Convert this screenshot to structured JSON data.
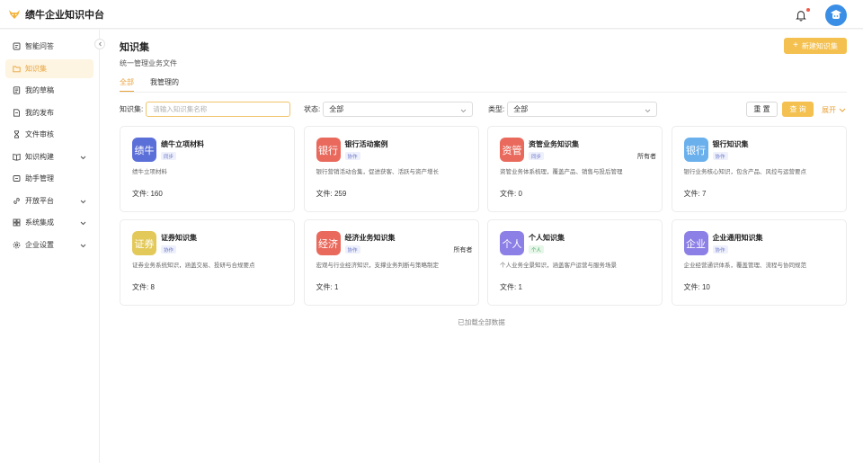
{
  "app": {
    "title": "绩牛企业知识中台"
  },
  "colors": {
    "accent": "#e8a33c",
    "primary_button": "#f4c150",
    "notification_dot": "#f05a4a",
    "avatar_bg": "#3a8ee6"
  },
  "sidebar": {
    "items": [
      {
        "label": "智能问答",
        "icon": "chat-doc-icon",
        "active": false,
        "expandable": false
      },
      {
        "label": "知识集",
        "icon": "folder-icon",
        "active": true,
        "expandable": false
      },
      {
        "label": "我的草稿",
        "icon": "draft-icon",
        "active": false,
        "expandable": false
      },
      {
        "label": "我的发布",
        "icon": "publish-icon",
        "active": false,
        "expandable": false
      },
      {
        "label": "文件审核",
        "icon": "hourglass-icon",
        "active": false,
        "expandable": false
      },
      {
        "label": "知识构建",
        "icon": "book-icon",
        "active": false,
        "expandable": true
      },
      {
        "label": "助手管理",
        "icon": "assistant-icon",
        "active": false,
        "expandable": false
      },
      {
        "label": "开放平台",
        "icon": "link-icon",
        "active": false,
        "expandable": true
      },
      {
        "label": "系统集成",
        "icon": "grid-icon",
        "active": false,
        "expandable": true
      },
      {
        "label": "企业设置",
        "icon": "gear-icon",
        "active": false,
        "expandable": true
      }
    ]
  },
  "header": {
    "title": "知识集",
    "subtitle": "统一管理业务文件",
    "new_button_label": "新建知识集"
  },
  "tabs": [
    {
      "label": "全部",
      "active": true
    },
    {
      "label": "我管理的",
      "active": false
    }
  ],
  "filters": {
    "name_label": "知识集:",
    "name_placeholder": "请输入知识集名称",
    "status_label": "状态:",
    "status_value": "全部",
    "type_label": "类型:",
    "type_value": "全部",
    "reset_label": "重 置",
    "query_label": "查 询",
    "expand_label": "展开"
  },
  "cards": [
    {
      "icon_text": "绩牛",
      "icon_color": "#5b6fd8",
      "name": "绩牛立项材料",
      "tag": "同步",
      "tag_type": "sync",
      "owner": "",
      "desc": "绩牛立项材料",
      "count": "文件: 160"
    },
    {
      "icon_text": "银行",
      "icon_color": "#e96a5d",
      "name": "银行活动案例",
      "tag": "协作",
      "tag_type": "collab",
      "owner": "",
      "desc": "银行营销活动合集，促进获客、活跃与资产增长",
      "count": "文件: 259"
    },
    {
      "icon_text": "资管",
      "icon_color": "#e96a5d",
      "name": "资管业务知识集",
      "tag": "同步",
      "tag_type": "sync",
      "owner": "所有者",
      "desc": "资管业务体系梳理，覆盖产品、销售与投后管理",
      "count": "文件: 0"
    },
    {
      "icon_text": "银行",
      "icon_color": "#6ab0ec",
      "name": "银行知识集",
      "tag": "协作",
      "tag_type": "collab",
      "owner": "",
      "desc": "银行业务核心知识，包含产品、风控与运营要点",
      "count": "文件: 7"
    },
    {
      "icon_text": "证券",
      "icon_color": "#e3c95a",
      "name": "证券知识集",
      "tag": "协作",
      "tag_type": "collab",
      "owner": "",
      "desc": "证券业务系统知识，涵盖交易、投研与合规要点",
      "count": "文件: 8"
    },
    {
      "icon_text": "经济",
      "icon_color": "#e96a5d",
      "name": "经济业务知识集",
      "tag": "协作",
      "tag_type": "collab",
      "owner": "所有者",
      "desc": "宏观与行业经济知识，支撑业务判断与策略制定",
      "count": "文件: 1"
    },
    {
      "icon_text": "个人",
      "icon_color": "#8c7fe6",
      "name": "个人知识集",
      "tag": "个人",
      "tag_type": "personal",
      "owner": "",
      "desc": "个人业务全景知识，涵盖客户运营与服务场景",
      "count": "文件: 1"
    },
    {
      "icon_text": "企业",
      "icon_color": "#8c7fe6",
      "name": "企业通用知识集",
      "tag": "协作",
      "tag_type": "collab",
      "owner": "",
      "desc": "企业经营通识体系，覆盖管理、流程与协同规范",
      "count": "文件: 10"
    }
  ],
  "footer": {
    "loaded_text": "已加载全部数据"
  }
}
